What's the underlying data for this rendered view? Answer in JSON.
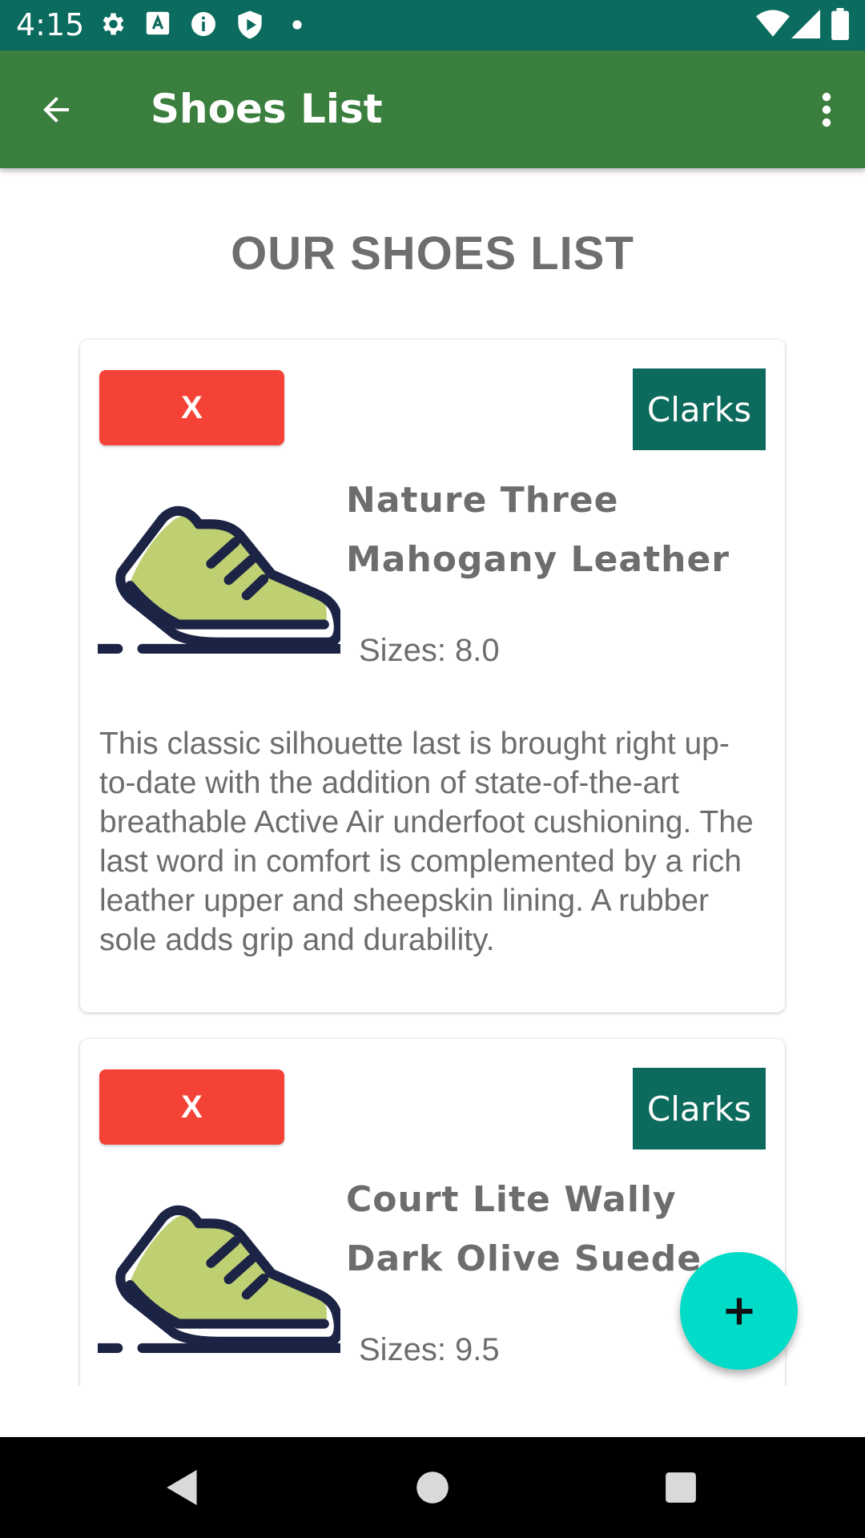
{
  "status_bar": {
    "time": "4:15",
    "left_icons": [
      "gear-icon",
      "a-icon",
      "info-icon",
      "play-protect-icon",
      "dot-icon"
    ],
    "right_icons": [
      "wifi-icon",
      "signal-icon",
      "battery-icon"
    ]
  },
  "app_bar": {
    "title": "Shoes List",
    "background": "#3a7f3d"
  },
  "heading": "OUR SHOES LIST",
  "shoes": [
    {
      "delete_label": "X",
      "brand": "Clarks",
      "name": "Nature Three Mahogany Leather",
      "sizes": "Sizes: 8.0",
      "description": "This classic silhouette last is brought right up-to-date with the addition of state-of-the-art breathable Active Air underfoot cushioning. The last word in comfort is complemented by a rich leather upper and sheepskin lining. A rubber sole adds grip and durability."
    },
    {
      "delete_label": "X",
      "brand": "Clarks",
      "name": "Court Lite Wally Dark Olive Suede",
      "sizes": "Sizes: 9.5",
      "description": ""
    }
  ],
  "fab": {
    "icon": "plus-icon",
    "color": "#00dcc7"
  },
  "colors": {
    "status_bar": "#0b6b5e",
    "delete_button": "#f44336",
    "brand_badge": "#0d6b5e"
  }
}
